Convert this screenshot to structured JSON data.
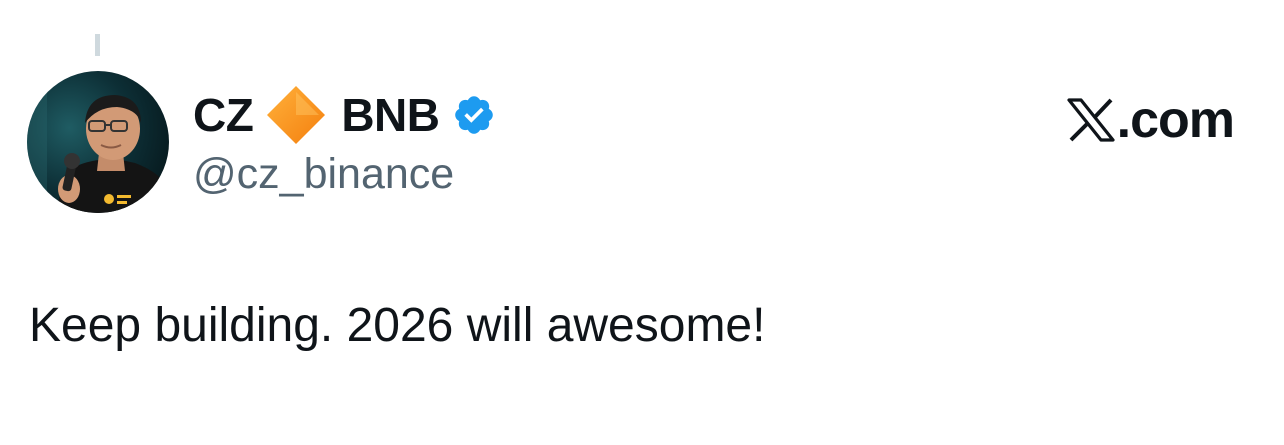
{
  "tweet": {
    "author": {
      "name_part1": "CZ",
      "name_part2": "BNB",
      "handle": "@cz_binance",
      "avatar": "profile-photo"
    },
    "source": "X.com",
    "text": "Keep building. 2026 will awesome!"
  },
  "icons": {
    "name_emoji": "orange-diamond-icon",
    "verified": "verified-badge-icon",
    "brand": "x-logo-icon"
  },
  "colors": {
    "name_text": "#0f1419",
    "handle_text": "#536471",
    "verified_blue": "#1d9bf0",
    "diamond_orange": "#f7931e",
    "thread_line": "#cfd9de"
  }
}
